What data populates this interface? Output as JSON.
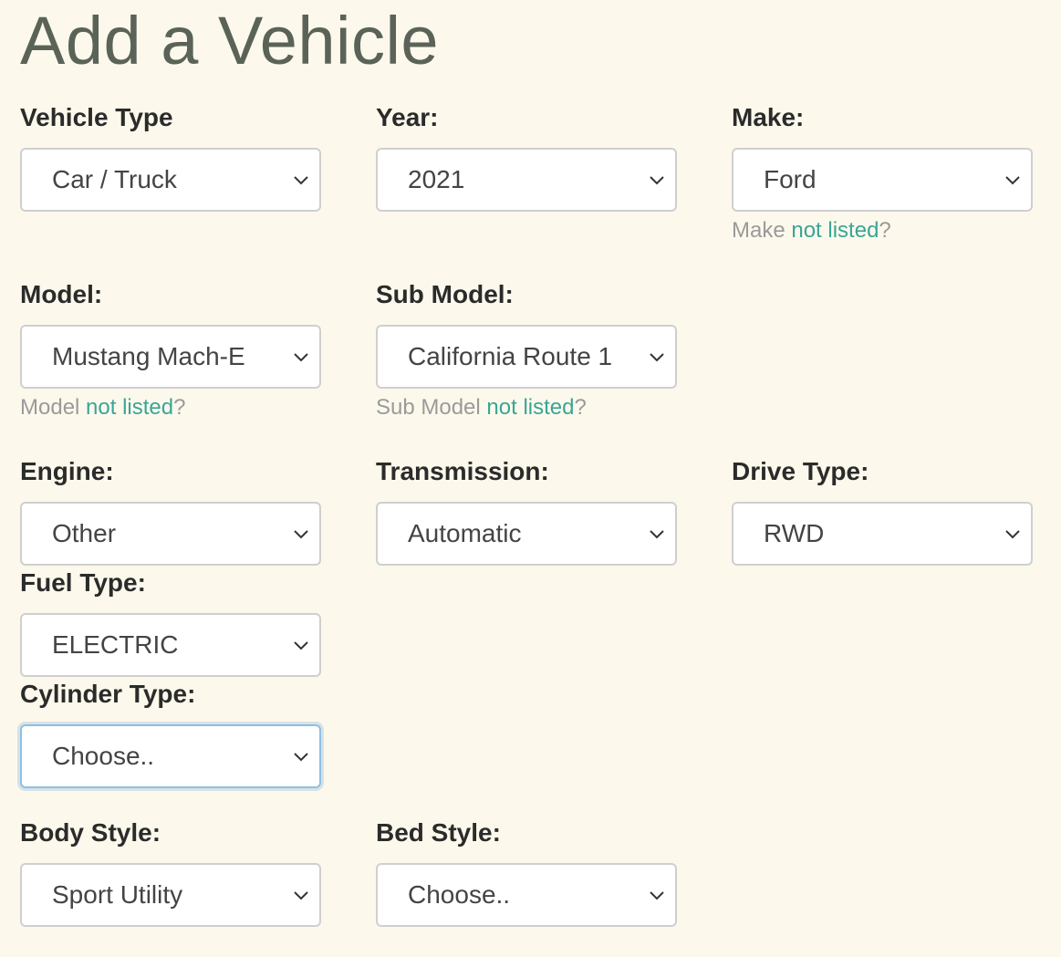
{
  "page": {
    "title": "Add a Vehicle"
  },
  "colors": {
    "background": "#fcf9ec",
    "title": "#5b6358",
    "link": "#3aa596",
    "muted": "#9a9a9a",
    "focus_border": "#8fbfe6"
  },
  "icons": {
    "dropdown": "chevron-down-icon"
  },
  "fields": {
    "vehicle_type": {
      "label": "Vehicle Type",
      "value": "Car / Truck"
    },
    "year": {
      "label": "Year:",
      "value": "2021"
    },
    "make": {
      "label": "Make:",
      "value": "Ford",
      "help_prefix": "Make ",
      "help_link": "not listed",
      "help_suffix": "?"
    },
    "model": {
      "label": "Model:",
      "value": "Mustang Mach-E",
      "help_prefix": "Model ",
      "help_link": "not listed",
      "help_suffix": "?"
    },
    "sub_model": {
      "label": "Sub Model:",
      "value": "California Route 1",
      "help_prefix": "Sub Model ",
      "help_link": "not listed",
      "help_suffix": "?"
    },
    "engine": {
      "label": "Engine:",
      "value": "Other"
    },
    "transmission": {
      "label": "Transmission:",
      "value": "Automatic"
    },
    "drive_type": {
      "label": "Drive Type:",
      "value": "RWD"
    },
    "fuel_type": {
      "label": "Fuel Type:",
      "value": "ELECTRIC"
    },
    "cylinder_type": {
      "label": "Cylinder Type:",
      "value": "Choose..",
      "focused": true
    },
    "body_style": {
      "label": "Body Style:",
      "value": "Sport Utility"
    },
    "bed_style": {
      "label": "Bed Style:",
      "value": "Choose.."
    }
  }
}
